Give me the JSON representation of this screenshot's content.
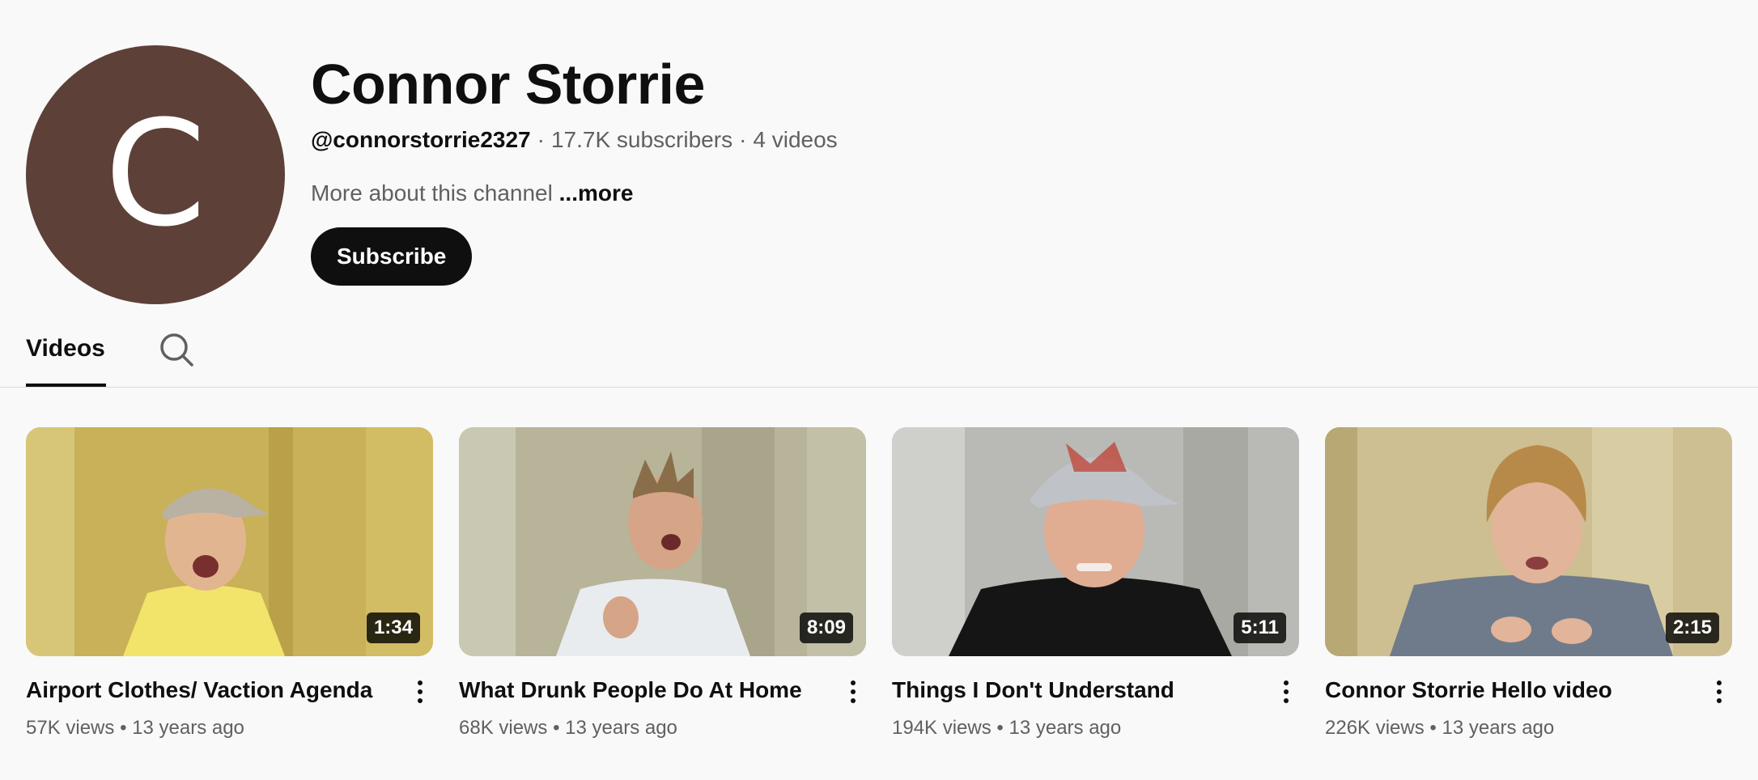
{
  "channel": {
    "avatar_letter": "C",
    "avatar_color": "#5d4037",
    "title": "Connor Storrie",
    "handle": "@connorstorrie2327",
    "separator": "·",
    "subscribers": "17.7K subscribers",
    "video_count": "4 videos",
    "description": "More about this channel",
    "more_label": "...more",
    "subscribe_label": "Subscribe"
  },
  "tabs": {
    "videos_label": "Videos",
    "search_icon": "search-icon"
  },
  "videos": [
    {
      "title": "Airport Clothes/ Vaction Agenda",
      "duration": "1:34",
      "views": "57K views",
      "age": "13 years ago",
      "thumb_bg": "#c9b15a",
      "shirt": "#f2e46a",
      "cap": "#b9b2a2"
    },
    {
      "title": "What Drunk People Do At Home",
      "duration": "8:09",
      "views": "68K views",
      "age": "13 years ago",
      "thumb_bg": "#b7b49a",
      "shirt": "#e8ecef",
      "cap": ""
    },
    {
      "title": "Things I Don't Understand",
      "duration": "5:11",
      "views": "194K views",
      "age": "13 years ago",
      "thumb_bg": "#b9b9b5",
      "shirt": "#151515",
      "cap": "#bfc3c8"
    },
    {
      "title": "Connor Storrie Hello video",
      "duration": "2:15",
      "views": "226K views",
      "age": "13 years ago",
      "thumb_bg": "#cdbf92",
      "shirt": "#6f7b8a",
      "cap": ""
    }
  ],
  "meta_dot": "•"
}
